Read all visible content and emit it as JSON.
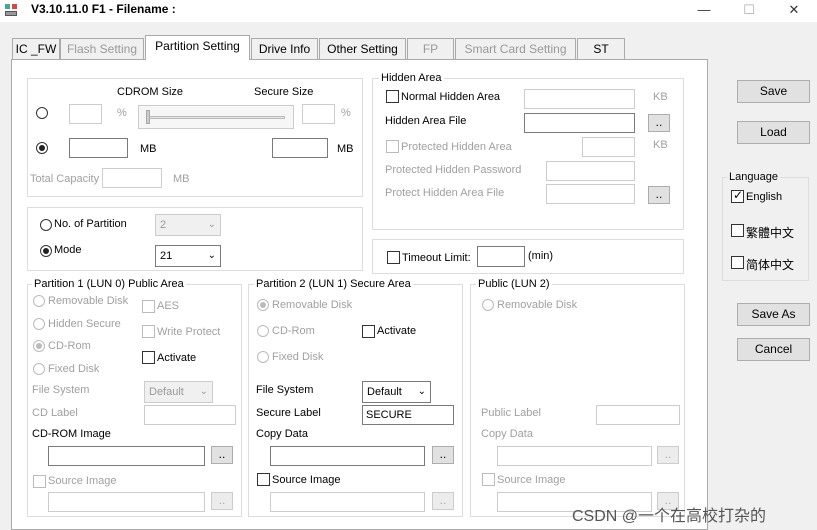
{
  "window": {
    "title": "V3.10.11.0 F1 - Filename :"
  },
  "window_controls": {
    "minimize": "—",
    "maximize": "☐",
    "close": "✕"
  },
  "tabs": [
    {
      "label": "IC _FW"
    },
    {
      "label": "Flash Setting"
    },
    {
      "label": "Partition Setting"
    },
    {
      "label": "Drive Info"
    },
    {
      "label": "Other Setting"
    },
    {
      "label": "FP"
    },
    {
      "label": "Smart Card Setting"
    },
    {
      "label": "ST"
    }
  ],
  "cdrom": {
    "cdrom_size_label": "CDROM Size",
    "secure_size_label": "Secure Size",
    "pct_unit": "%",
    "mb_unit": "MB",
    "total_capacity_label": "Total Capacity",
    "total_unit": "MB",
    "pct_value": 0
  },
  "partition_mode": {
    "no_of_partition_label": "No. of Partition",
    "no_of_partition_value": "2",
    "mode_label": "Mode",
    "mode_value": "21"
  },
  "hidden_area": {
    "title": "Hidden Area",
    "normal_label": "Normal Hidden Area",
    "kb_unit": "KB",
    "file_label": "Hidden Area File",
    "browse": "..",
    "protected_label": "Protected Hidden Area",
    "kb_unit2": "KB",
    "protected_password_label": "Protected Hidden Password",
    "protect_file_label": "Protect Hidden Area File",
    "browse2": ".."
  },
  "timeout": {
    "label": "Timeout Limit:",
    "unit": "(min)"
  },
  "partition1": {
    "title": "Partition 1 (LUN 0) Public Area",
    "removable": "Removable Disk",
    "hidden_secure": "Hidden Secure",
    "cdrom": "CD-Rom",
    "fixed": "Fixed Disk",
    "aes": "AES",
    "write_protect": "Write Protect",
    "activate": "Activate",
    "file_system_label": "File System",
    "file_system_value": "Default",
    "cd_label": "CD Label",
    "cdrom_image_label": "CD-ROM Image",
    "browse": "..",
    "source_image_label": "Source Image",
    "browse2": ".."
  },
  "partition2": {
    "title": "Partition 2 (LUN 1) Secure Area",
    "removable": "Removable Disk",
    "cdrom": "CD-Rom",
    "fixed": "Fixed Disk",
    "activate": "Activate",
    "file_system_label": "File System",
    "file_system_value": "Default",
    "secure_label_label": "Secure Label",
    "secure_label_value": "SECURE",
    "copy_data_label": "Copy Data",
    "browse": "..",
    "source_image_label": "Source Image",
    "browse2": ".."
  },
  "public_lun2": {
    "title": "Public (LUN 2)",
    "removable": "Removable Disk",
    "public_label": "Public Label",
    "copy_data_label": "Copy Data",
    "browse": "..",
    "source_image_label": "Source Image",
    "browse2": ".."
  },
  "right_panel": {
    "save": "Save",
    "load": "Load",
    "language_title": "Language",
    "lang_english": "English",
    "lang_trad": "繁體中文",
    "lang_simp": "简体中文",
    "save_as": "Save As",
    "cancel": "Cancel"
  },
  "watermark": "CSDN @一个在高校打杂的"
}
